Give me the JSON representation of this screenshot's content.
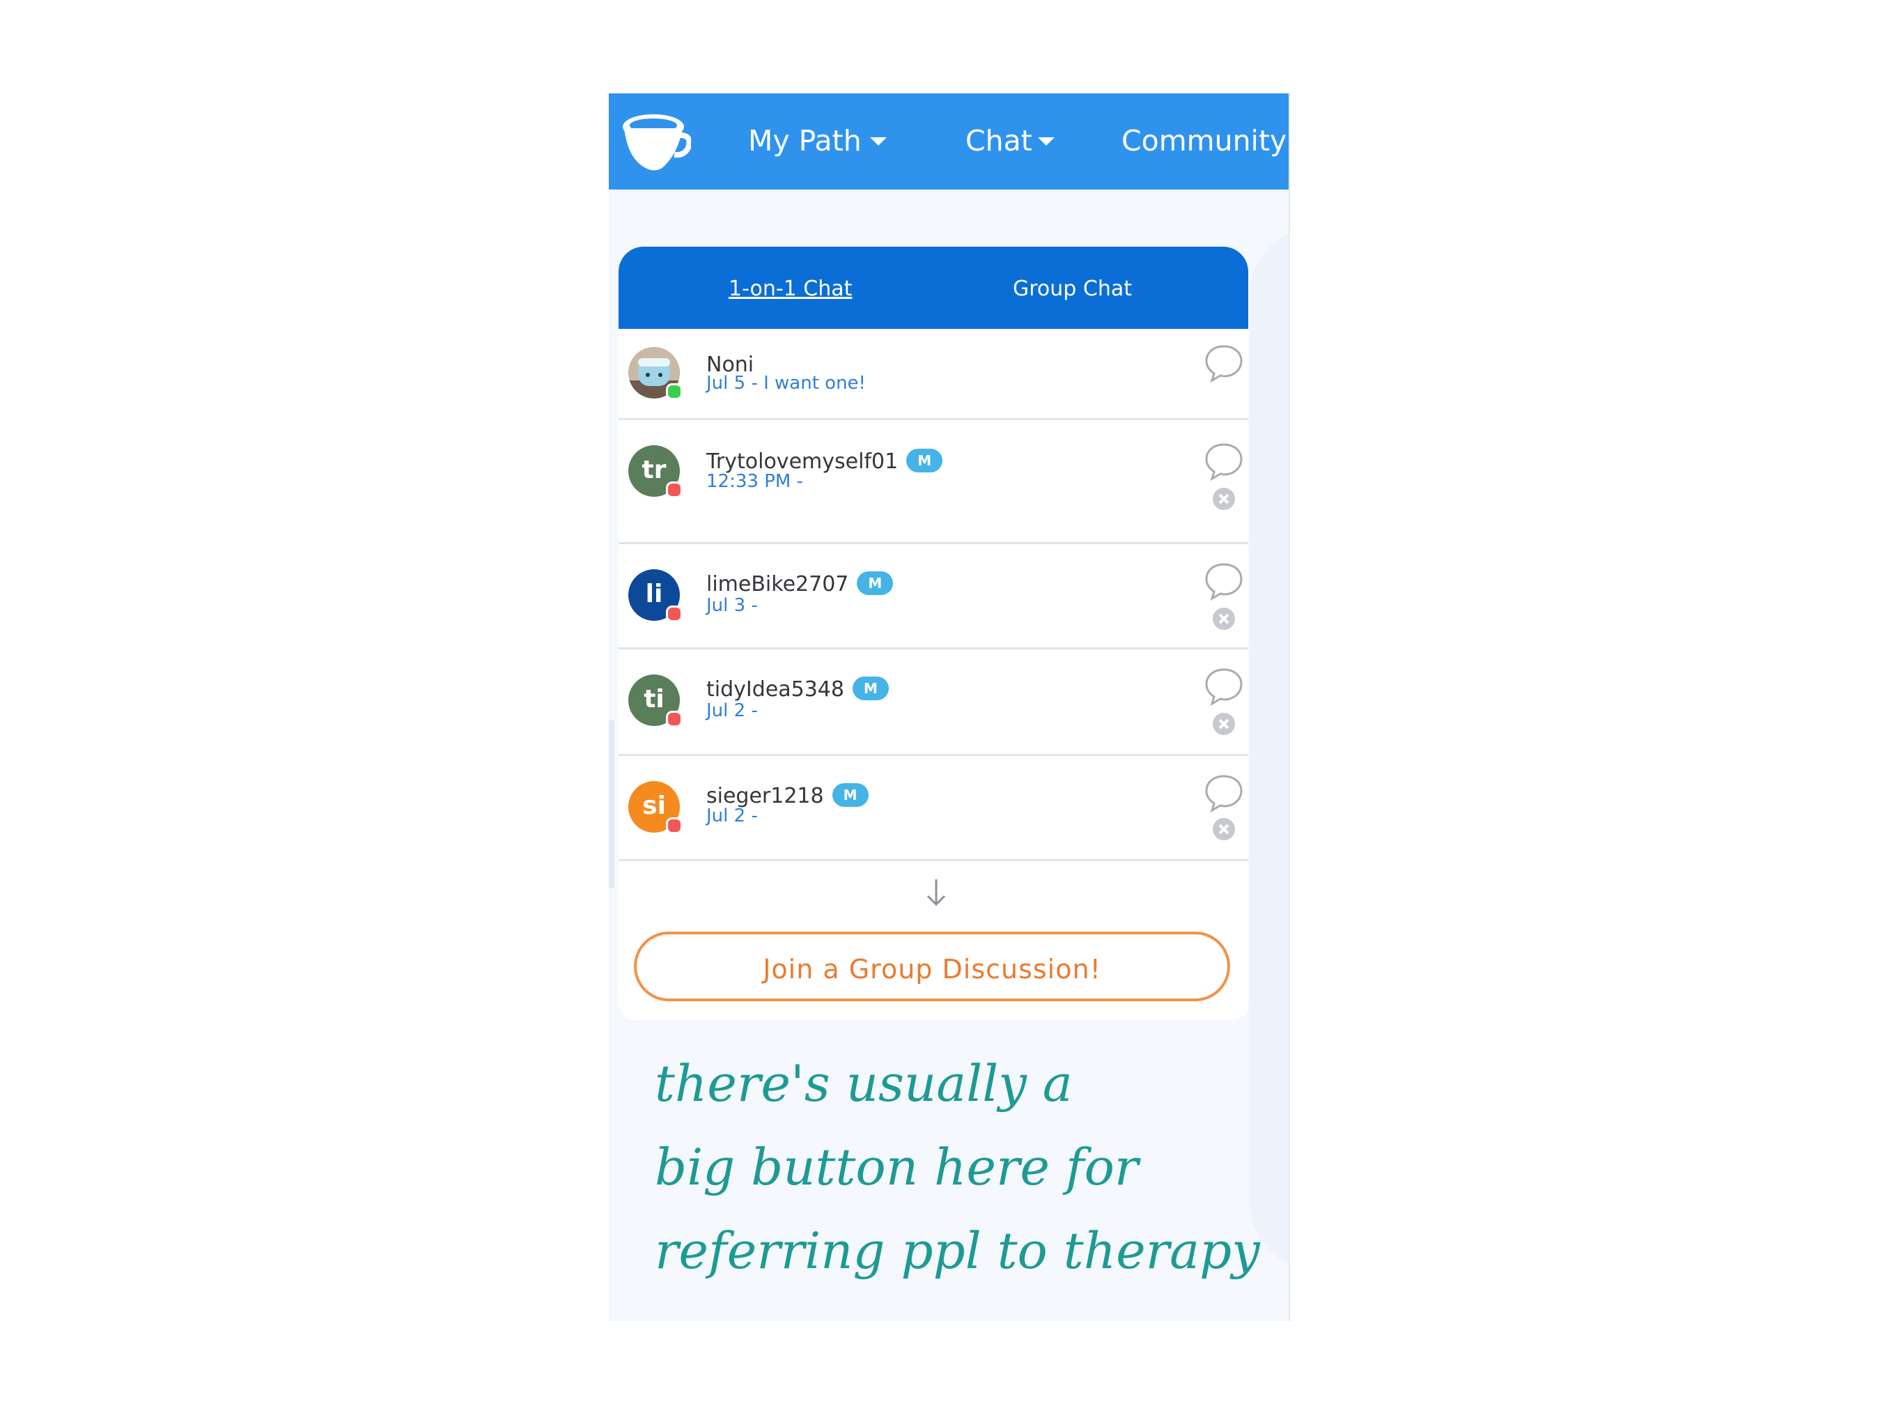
{
  "colors": {
    "navbar": "#2f93ee",
    "tabbar": "#0a6ed6",
    "preview_text": "#2f7fd6",
    "badge": "#45b3e6",
    "online": "#3ccf4e",
    "offline": "#f25757",
    "join_button": "#f39247",
    "annotation_ink": "#1e9a94"
  },
  "navbar": {
    "logo_icon": "teacup-logo-icon",
    "items": [
      {
        "label": "My Path"
      },
      {
        "label": "Chat"
      },
      {
        "label": "Community"
      }
    ]
  },
  "tabs": {
    "one_on_one": "1-on-1 Chat",
    "group": "Group Chat"
  },
  "conversations": [
    {
      "name": "Noni",
      "badge": "",
      "preview": "Jul 5 - I want one!",
      "status": "online",
      "avatar_text": "",
      "avatar_color": "#7fb6d6"
    },
    {
      "name": "Trytolovemyself01",
      "badge": "M",
      "preview": "12:33 PM -",
      "status": "offline",
      "avatar_text": "tr",
      "avatar_color": "#5a7d5a"
    },
    {
      "name": "limeBike2707",
      "badge": "M",
      "preview": "Jul 3 -",
      "status": "offline",
      "avatar_text": "li",
      "avatar_color": "#0c4a99"
    },
    {
      "name": "tidyIdea5348",
      "badge": "M",
      "preview": "Jul 2 -",
      "status": "offline",
      "avatar_text": "ti",
      "avatar_color": "#5a7d5a"
    },
    {
      "name": "sieger1218",
      "badge": "M",
      "preview": "Jul 2 -",
      "status": "offline",
      "avatar_text": "si",
      "avatar_color": "#f58a1f"
    }
  ],
  "join_button": "Join a Group Discussion!",
  "annotation": "there's usually a big button here for referring ppl to therapy"
}
